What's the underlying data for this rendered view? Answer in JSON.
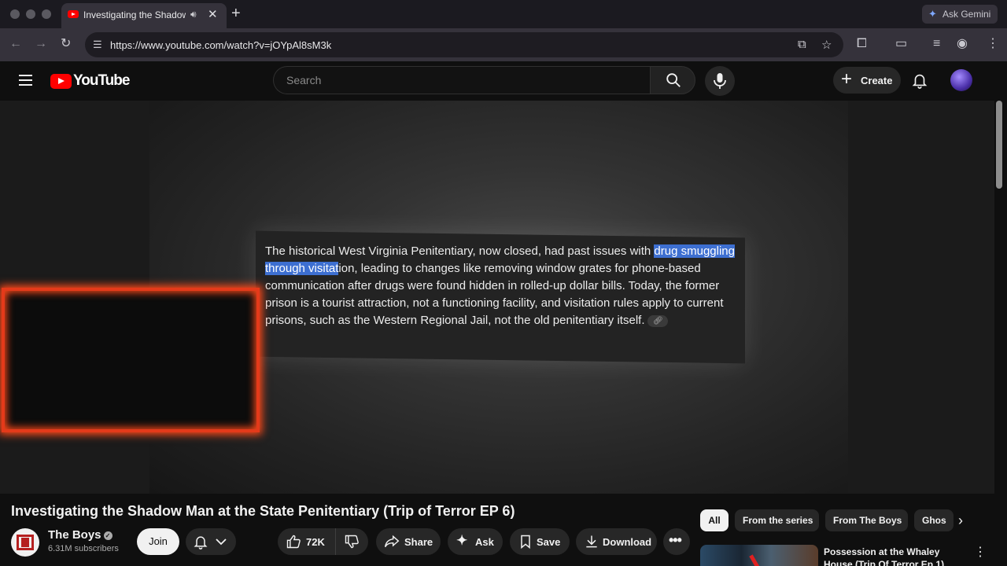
{
  "browser": {
    "tab_title": "Investigating the Shadow",
    "url": "https://www.youtube.com/watch?v=jOYpAl8sM3k",
    "ask_gemini": "Ask Gemini"
  },
  "masthead": {
    "logo_text": "YouTube",
    "search_placeholder": "Search",
    "create_label": "Create"
  },
  "player": {
    "overlay_text_before": "The historical West Virginia Penitentiary, now closed, had past issues with ",
    "overlay_highlight": "drug smuggling through visitat",
    "overlay_text_after": "ion, leading to changes like removing window grates for phone-based communication after drugs were found hidden in rolled-up dollar bills. Today, the former prison is a tourist attraction, not a functioning facility, and visitation rules apply to current prisons, such as the Western Regional Jail, not the old penitentiary itself."
  },
  "video": {
    "title": "Investigating the Shadow Man at the State Penitentiary (Trip of Terror EP 6)",
    "channel_name": "The Boys",
    "subscribers": "6.31M subscribers",
    "join_label": "Join",
    "like_count": "72K",
    "share_label": "Share",
    "ask_label": "Ask",
    "save_label": "Save",
    "download_label": "Download"
  },
  "sidebar": {
    "chips": [
      "All",
      "From the series",
      "From The Boys",
      "Ghos"
    ],
    "recommended_title": "Possession at the Whaley House (Trip Of Terror Ep 1)"
  },
  "colors": {
    "youtube_red": "#ff0000",
    "highlight_blue": "#3d6fd1",
    "fire_frame": "#e43a1a"
  }
}
